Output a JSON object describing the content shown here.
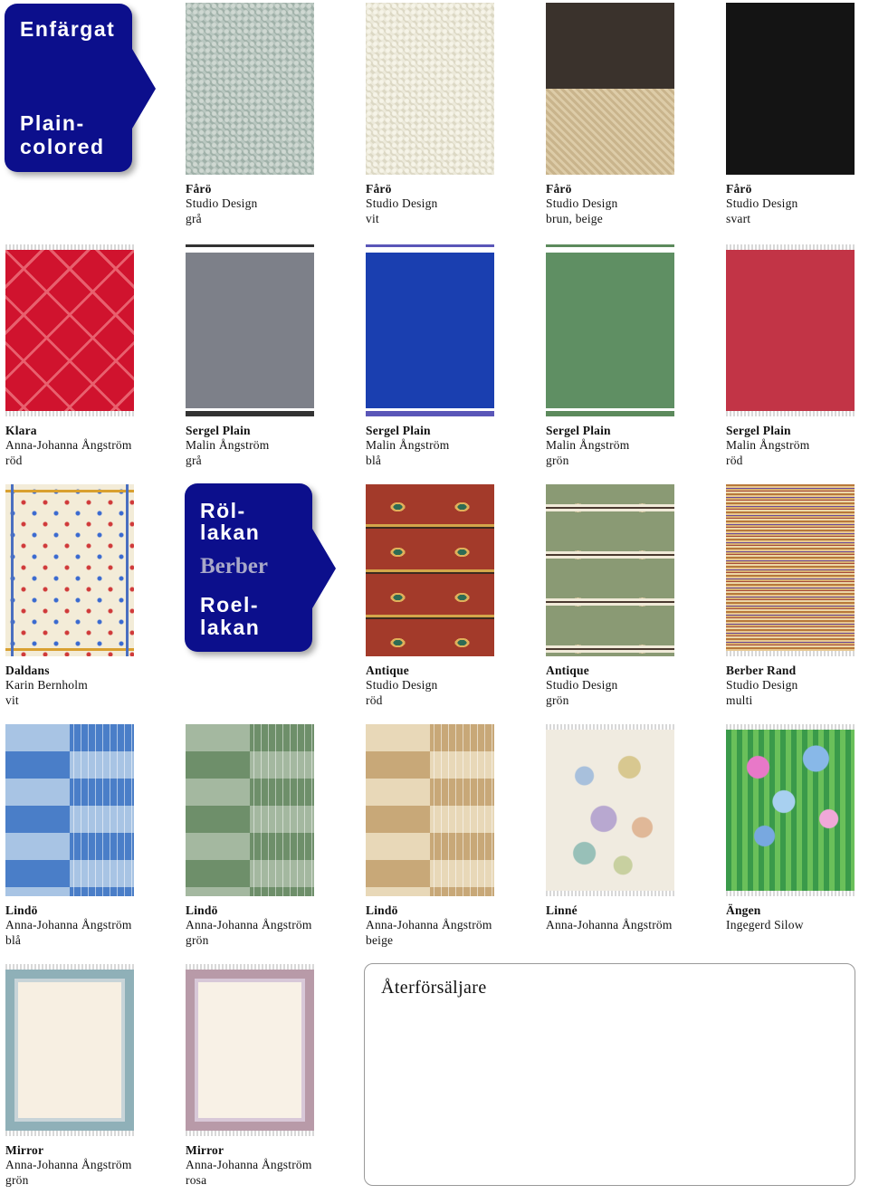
{
  "labels": {
    "solid_sv": "Enfärgat",
    "solid_en_1": "Plain-",
    "solid_en_2": "colored",
    "rollakan_sv_1": "Röl-",
    "rollakan_sv_2": "lakan",
    "berber": "Berber",
    "rollakan_en_1": "Roel-",
    "rollakan_en_2": "lakan"
  },
  "rugs": [
    {
      "name": "Fårö",
      "designer": "Studio Design",
      "color": "grå"
    },
    {
      "name": "Fårö",
      "designer": "Studio Design",
      "color": "vit"
    },
    {
      "name": "Fårö",
      "designer": "Studio Design",
      "color": "brun, beige"
    },
    {
      "name": "Fårö",
      "designer": "Studio Design",
      "color": "svart"
    },
    {
      "name": "Klara",
      "designer": "Anna-Johanna Ångström",
      "color": "röd"
    },
    {
      "name": "Sergel Plain",
      "designer": "Malin Ångström",
      "color": "grå"
    },
    {
      "name": "Sergel Plain",
      "designer": "Malin Ångström",
      "color": "blå"
    },
    {
      "name": "Sergel Plain",
      "designer": "Malin Ångström",
      "color": "grön"
    },
    {
      "name": "Sergel Plain",
      "designer": "Malin Ångström",
      "color": "röd"
    },
    {
      "name": "Daldans",
      "designer": "Karin Bernholm",
      "color": "vit"
    },
    {
      "name": "Antique",
      "designer": "Studio Design",
      "color": "röd"
    },
    {
      "name": "Antique",
      "designer": "Studio Design",
      "color": "grön"
    },
    {
      "name": "Berber Rand",
      "designer": "Studio Design",
      "color": "multi"
    },
    {
      "name": "Lindö",
      "designer": "Anna-Johanna Ångström",
      "color": "blå"
    },
    {
      "name": "Lindö",
      "designer": "Anna-Johanna Ångström",
      "color": "grön"
    },
    {
      "name": "Lindö",
      "designer": "Anna-Johanna Ångström",
      "color": "beige"
    },
    {
      "name": "Linné",
      "designer": "Anna-Johanna Ångström",
      "color": ""
    },
    {
      "name": "Ängen",
      "designer": "Ingegerd Silow",
      "color": ""
    },
    {
      "name": "Mirror",
      "designer": "Anna-Johanna Ångström",
      "color": "grön"
    },
    {
      "name": "Mirror",
      "designer": "Anna-Johanna Ångström",
      "color": "rosa"
    }
  ],
  "dealer": {
    "title": "Återförsäljare"
  },
  "colors": {
    "label_blue": "#0c0f8c"
  }
}
